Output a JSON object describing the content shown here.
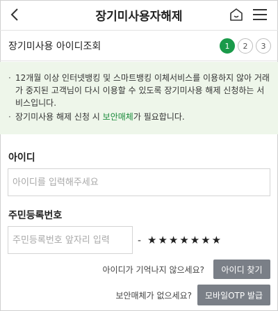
{
  "header": {
    "title": "장기미사용자해제",
    "back_icon": "chevron-left-icon",
    "home_icon": "home-icon",
    "menu_icon": "hamburger-menu-icon"
  },
  "section": {
    "title": "장기미사용 아이디조회",
    "steps": [
      "1",
      "2",
      "3"
    ],
    "active_step": "1",
    "accent_color": "#1a9a4a"
  },
  "notice": {
    "item1": "12개월 이상 인터넷뱅킹 및 스마트뱅킹 이체서비스를 이용하지 않아 거래가 중지된 고객님이 다시 이용할 수 있도록 장기미사용 해제 신청하는 서비스입니다.",
    "item2_prefix": "장기미사용 해제 신청 시 ",
    "item2_highlight": "보안매체",
    "item2_suffix": "가 필요합니다."
  },
  "form": {
    "id_label": "아이디",
    "id_placeholder": "아이디를 입력해주세요",
    "rrn_label": "주민등록번호",
    "rrn_placeholder": "주민등록번호 앞자리 입력",
    "rrn_dash": "-",
    "rrn_masked": "★★★★★★★"
  },
  "help": {
    "forgot_id_text": "아이디가 기억나지 않으세요?",
    "find_id_button": "아이디 찾기",
    "no_media_text": "보안매체가 없으세요?",
    "otp_button": "모바일OTP 발급"
  }
}
